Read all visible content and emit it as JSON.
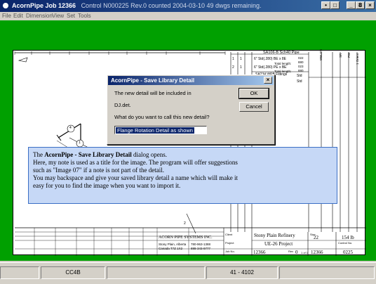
{
  "window": {
    "title_app": "AcornPipe Job 12366",
    "title_detail": "Control N000225 Rev.0 counted 2004-03-10  49 dwgs remaining.",
    "controls": [
      "•",
      "□",
      "_",
      "8",
      "×"
    ]
  },
  "menu": {
    "items": [
      "File",
      "Edit",
      "Dimension",
      "View",
      "Set",
      "Tools"
    ]
  },
  "drawing": {
    "bom_heading": "SA106-B Sch40 Pipe",
    "bom_rows": [
      {
        "item": "1",
        "qty": "1",
        "desc": "6\" Std(.280) BE x 8E",
        "total_label": "Total length:",
        "total": "022",
        "extra": "880"
      },
      {
        "item": "2",
        "qty": "1",
        "desc": "6\" Std(.280) PE x BE",
        "total_label": "Total length:",
        "total": "023",
        "extra": "880"
      }
    ],
    "bom_fittings_heading": "SA234 WPB Fittings",
    "bom_fittings_row": "reducer",
    "bom_std": [
      "Std",
      "Std"
    ],
    "vert_headers": [
      "WELDS",
      "SR",
      "FW",
      "1 Orient"
    ],
    "company": "ACORN PIPE SYSTEMS INC.",
    "address_line1": "Stony Plain, Alberta",
    "address_line2": "Canada T7Z 1X2",
    "phone1": "780-963-1388",
    "phone2": "888-343-9777",
    "client_label": "Client",
    "client": "Stony Plain Refinery",
    "project_label": "Project",
    "project": "UE-26 Project",
    "job_label": "Job No.",
    "job_value": "12366",
    "size_label": "Size",
    "size_value": "22",
    "weight_value": "154 lb",
    "rev_label": "Rev",
    "rev_value": "0",
    "sheet_value": "1 of 1",
    "control_label": "Control No.",
    "control_value": "0225",
    "balloon_4": "4",
    "balloon_1": "1",
    "balloon_2": "2"
  },
  "dialog": {
    "title": "AcornPipe - Save Library Detail",
    "close": "×",
    "line1": "The new detail will be included in",
    "line2": "DJ.det.",
    "line3": "What do you want to call this new detail?",
    "input_value": "Flange Rotation Detail as shown",
    "ok_label": "OK",
    "cancel_label": "Cancel"
  },
  "callout": {
    "line1_prefix": "The ",
    "line1_bold": "AcornPipe - Save Library Detail",
    "line1_suffix": " dialog opens.",
    "line2": "Here, my note is used as a title for the image. The program will offer suggestions",
    "line3": "such as \"Image 07\" if  a note is not part of the detail.",
    "line4": "You may backspace and give your saved library detail a name which will make it",
    "line5": "easy for you to find the image when you want to import it."
  },
  "status": {
    "panel1": "CC4B",
    "panel2": "41 - 4102"
  }
}
